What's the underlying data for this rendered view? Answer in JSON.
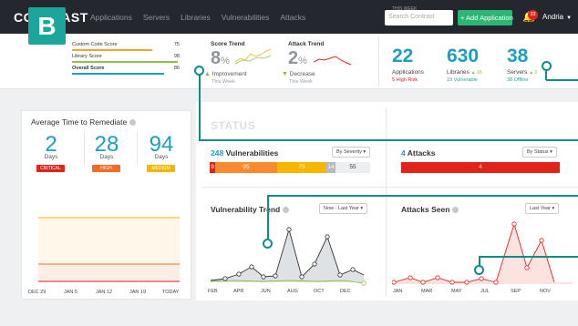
{
  "nav": {
    "logo": "CONTRAST",
    "items": [
      "Applications",
      "Servers",
      "Libraries",
      "Vulnerabilities",
      "Attacks"
    ],
    "search_placeholder": "Search Contrast",
    "add_button": "+ Add Application",
    "notifications": "33",
    "user": "Andria"
  },
  "summary": {
    "grade": "B",
    "scores": [
      {
        "label": "Custom Code Score",
        "value": "75",
        "color": "#f5a623"
      },
      {
        "label": "Library Score",
        "value": "98",
        "color": "#8bc53f"
      },
      {
        "label": "Overall Score",
        "value": "86",
        "color": "#1a9ec2"
      }
    ],
    "score_trend": {
      "title": "Score Trend",
      "value": "8",
      "unit": "%",
      "label": "Improvement",
      "sub": "This Week"
    },
    "attack_trend": {
      "title": "Attack Trend",
      "value": "2",
      "unit": "%",
      "label": "Decrease",
      "sub": "This Week"
    },
    "this_week": "THIS WEEK",
    "applications": {
      "value": "22",
      "label": "Applications",
      "sub": "5 High Risk"
    },
    "libraries": {
      "value": "630",
      "label": "Libraries",
      "delta": "▲ 16",
      "sub": "19 Vulnerable"
    },
    "servers": {
      "value": "38",
      "label": "Servers",
      "delta": "▲ 2",
      "sub": "38 Offline"
    }
  },
  "remediate": {
    "title": "Average Time to Remediate",
    "items": [
      {
        "value": "2",
        "unit": "Days",
        "badge": "CRITICAL",
        "color": "#e2231a"
      },
      {
        "value": "28",
        "unit": "Days",
        "badge": "HIGH",
        "color": "#f26c21"
      },
      {
        "value": "94",
        "unit": "Days",
        "badge": "MEDIUM",
        "color": "#f7b500"
      }
    ],
    "x_labels": [
      "DEC 29",
      "JAN 5",
      "JAN 12",
      "JAN 19",
      "TODAY"
    ]
  },
  "status": {
    "title": "STATUS",
    "vulnerabilities": {
      "count": "248",
      "label": "Vulnerabilities",
      "filter": "By Severity",
      "segments": [
        {
          "value": "9",
          "color": "#e2231a"
        },
        {
          "value": "95",
          "color": "#f7892f"
        },
        {
          "value": "75",
          "color": "#f7b500"
        },
        {
          "value": "14",
          "color": "#b5babf"
        },
        {
          "value": "55",
          "color": "#eceeef"
        }
      ]
    },
    "attacks": {
      "count": "4",
      "label": "Attacks",
      "filter": "By Status",
      "bar_value": "4",
      "bar_color": "#e2231a"
    },
    "vuln_trend": {
      "title": "Vulnerability Trend",
      "filter": "Now - Last Year",
      "x_labels": [
        "FEB",
        "APR",
        "JUN",
        "AUG",
        "OCT",
        "DEC"
      ]
    },
    "attacks_seen": {
      "title": "Attacks Seen",
      "filter": "Last Year",
      "x_labels": [
        "JAN",
        "MAR",
        "MAY",
        "JUL",
        "SEP",
        "NOV"
      ]
    }
  }
}
